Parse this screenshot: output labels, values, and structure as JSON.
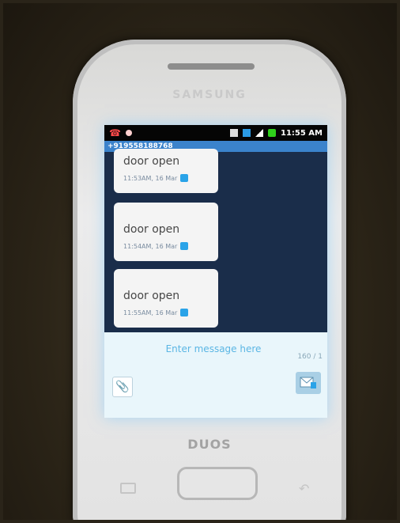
{
  "device": {
    "brand": "SAMSUNG",
    "model_badge": "DUOS"
  },
  "status_bar": {
    "time": "11:55 AM",
    "icons": [
      "missed-call-icon",
      "notification-dot-icon",
      "gallery-icon",
      "sim-icon",
      "signal-icon",
      "battery-icon"
    ]
  },
  "conversation": {
    "contact": "+919558188768",
    "messages": [
      {
        "text": "door open",
        "time": "11:53AM, 16 Mar"
      },
      {
        "text": "door open",
        "time": "11:54AM, 16 Mar"
      },
      {
        "text": "door open",
        "time": "11:55AM, 16 Mar"
      }
    ]
  },
  "composer": {
    "placeholder": "Enter message here",
    "char_counter": "160 / 1"
  }
}
